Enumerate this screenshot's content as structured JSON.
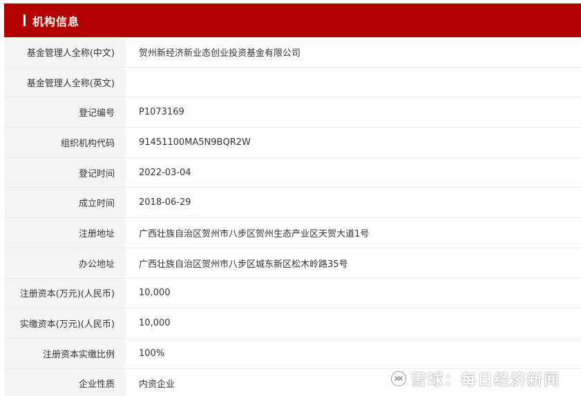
{
  "header": {
    "title": "机构信息",
    "accent_color": "#b50000"
  },
  "rows": [
    {
      "label": "基金管理人全称(中文)",
      "value": "贺州新经济新业态创业投资基金有限公司"
    },
    {
      "label": "基金管理人全称(英文)",
      "value": ""
    },
    {
      "label": "登记编号",
      "value": "P1073169"
    },
    {
      "label": "组织机构代码",
      "value": "91451100MA5N9BQR2W"
    },
    {
      "label": "登记时间",
      "value": "2022-03-04"
    },
    {
      "label": "成立时间",
      "value": "2018-06-29"
    },
    {
      "label": "注册地址",
      "value": "广西壮族自治区贺州市八步区贺州生态产业区天贺大道1号"
    },
    {
      "label": "办公地址",
      "value": "广西壮族自治区贺州市八步区城东新区松木岭路35号"
    },
    {
      "label": "注册资本(万元)(人民币)",
      "value": "10,000"
    },
    {
      "label": "实缴资本(万元)(人民币)",
      "value": "10,000"
    },
    {
      "label": "注册资本实缴比例",
      "value": "100%"
    },
    {
      "label": "企业性质",
      "value": "内资企业"
    }
  ],
  "watermark": {
    "icon": "xueqiu-logo-icon",
    "text": "雪球：每日经济新闻"
  }
}
